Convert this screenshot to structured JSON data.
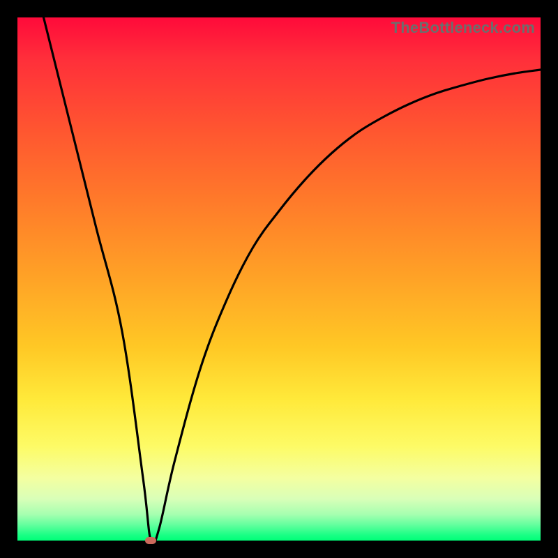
{
  "watermark": "TheBottleneck.com",
  "colors": {
    "page_bg": "#000000",
    "curve": "#000000",
    "marker": "#cc6a5c",
    "watermark_text": "#6d6d6d"
  },
  "chart_data": {
    "type": "line",
    "title": "",
    "xlabel": "",
    "ylabel": "",
    "xlim": [
      0,
      100
    ],
    "ylim": [
      0,
      100
    ],
    "grid": false,
    "legend": false,
    "series": [
      {
        "name": "bottleneck-curve",
        "x": [
          5,
          10,
          15,
          20,
          24,
          25.5,
          27,
          30,
          35,
          40,
          45,
          50,
          55,
          60,
          65,
          70,
          75,
          80,
          85,
          90,
          95,
          100
        ],
        "y": [
          100,
          80,
          60,
          40,
          12,
          0,
          2,
          15,
          33,
          46,
          56,
          63,
          69,
          74,
          78,
          81,
          83.5,
          85.5,
          87,
          88.3,
          89.3,
          90
        ]
      }
    ],
    "marker": {
      "x": 25.5,
      "y": 0
    },
    "gradient_stops": [
      {
        "pos": 0.0,
        "color": "#ff0a3a"
      },
      {
        "pos": 0.5,
        "color": "#ffa326"
      },
      {
        "pos": 0.82,
        "color": "#fdfb66"
      },
      {
        "pos": 1.0,
        "color": "#00ff78"
      }
    ]
  }
}
